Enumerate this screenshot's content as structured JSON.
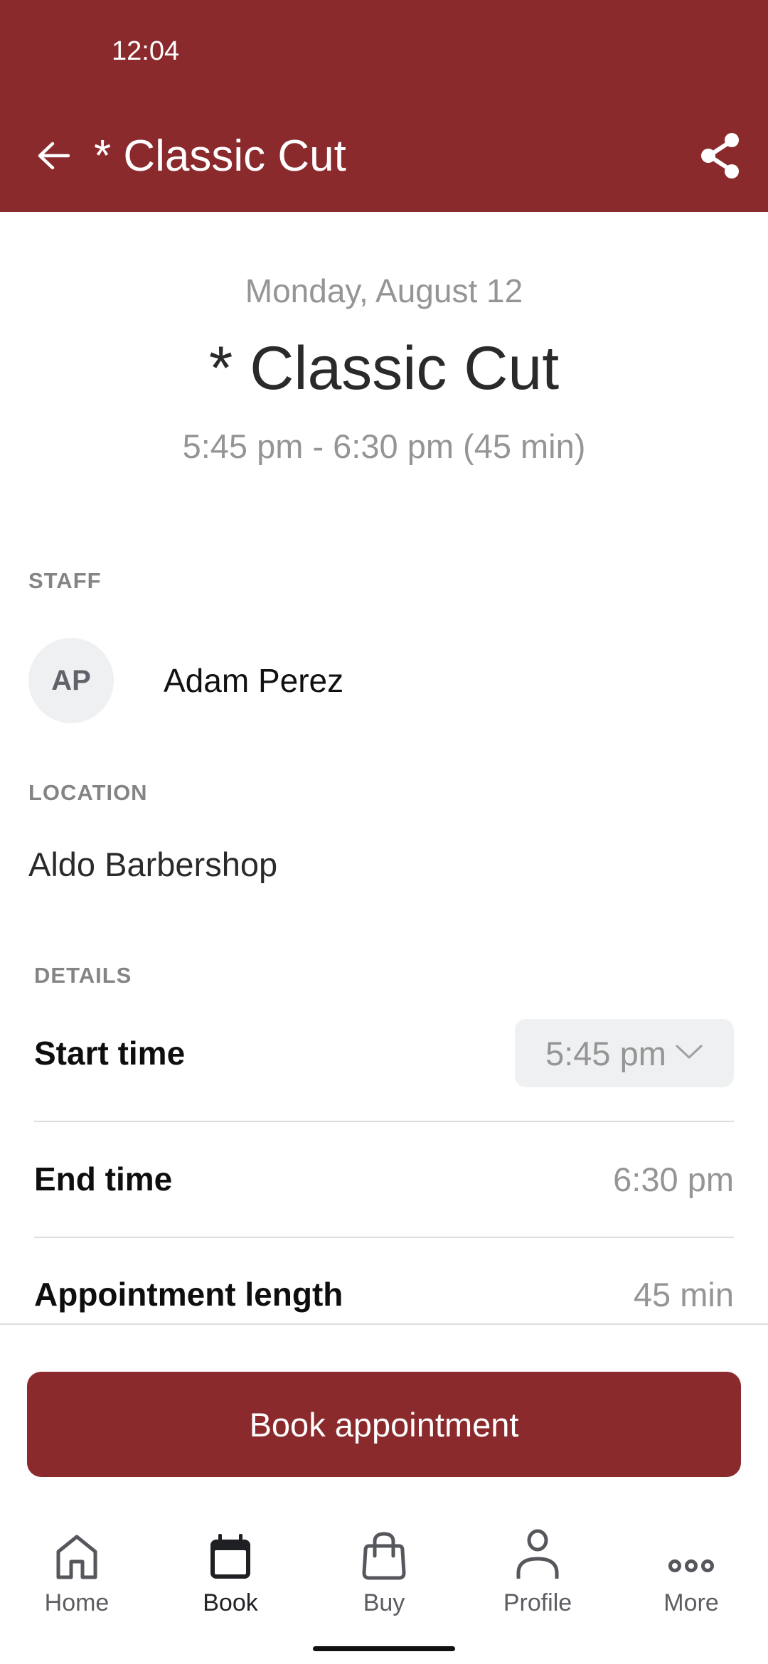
{
  "status_bar": {
    "time": "12:04"
  },
  "app_bar": {
    "title": "* Classic Cut",
    "back_icon": "arrow-left-icon",
    "share_icon": "share-icon",
    "background_color": "#8B2A2C"
  },
  "hero": {
    "date": "Monday, August 12",
    "service_name": "* Classic Cut",
    "time_range": "5:45 pm - 6:30 pm (45 min)"
  },
  "staff": {
    "label": "STAFF",
    "initials": "AP",
    "name": "Adam Perez"
  },
  "location": {
    "label": "LOCATION",
    "name": "Aldo Barbershop"
  },
  "details": {
    "label": "DETAILS",
    "rows": [
      {
        "label": "Start time",
        "value": "5:45 pm",
        "type": "select"
      },
      {
        "label": "End time",
        "value": "6:30 pm",
        "type": "text"
      },
      {
        "label": "Appointment length",
        "value": "45 min",
        "type": "text"
      }
    ]
  },
  "primary_action": {
    "label": "Book appointment",
    "color": "#8B2A2C"
  },
  "tab_bar": {
    "active": "Book",
    "items": [
      {
        "label": "Home",
        "icon": "home-icon"
      },
      {
        "label": "Book",
        "icon": "calendar-icon"
      },
      {
        "label": "Buy",
        "icon": "shopping-bag-icon"
      },
      {
        "label": "Profile",
        "icon": "person-icon"
      },
      {
        "label": "More",
        "icon": "more-dots-icon"
      }
    ]
  }
}
